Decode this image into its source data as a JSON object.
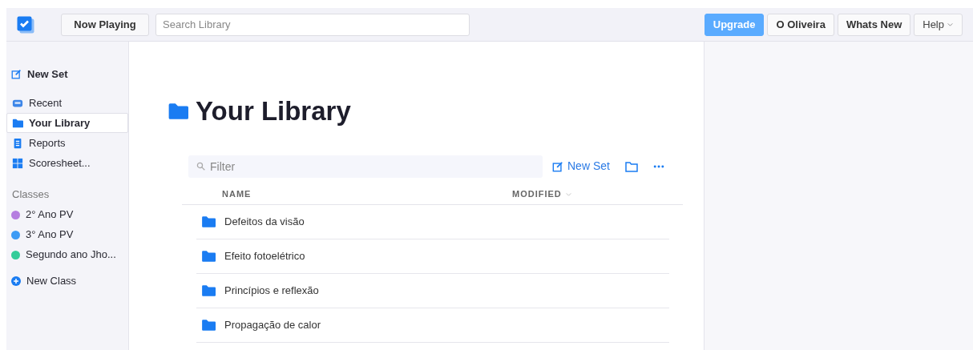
{
  "header": {
    "now_playing": "Now Playing",
    "search": {
      "placeholder": "Search Library"
    },
    "buttons": [
      {
        "label": "Upgrade",
        "kind": "primary"
      },
      {
        "label": "O Oliveira",
        "kind": "plain"
      },
      {
        "label": "Whats New",
        "kind": "plain"
      },
      {
        "label": "Help",
        "kind": "dropdown"
      }
    ]
  },
  "sidebar": {
    "new_set": "New Set",
    "items": [
      {
        "label": "Recent",
        "selected": false
      },
      {
        "label": "Your Library",
        "selected": true
      },
      {
        "label": "Reports",
        "selected": false
      },
      {
        "label": "Scoresheet...",
        "selected": false
      }
    ],
    "classes_heading": "Classes",
    "classes": [
      {
        "label": "2° Ano PV",
        "color": "#b57ee0"
      },
      {
        "label": "3° Ano PV",
        "color": "#3d9bf5"
      },
      {
        "label": "Segundo ano Jho...",
        "color": "#33cc99"
      }
    ],
    "new_class": "New Class"
  },
  "main": {
    "title": "Your Library",
    "filter": {
      "placeholder": "Filter"
    },
    "new_set": "New Set",
    "columns": [
      "NAME",
      "MODIFIED"
    ],
    "rows": [
      {
        "name": "Defeitos da visão"
      },
      {
        "name": "Efeito fotoelétrico"
      },
      {
        "name": "Princípios e reflexão"
      },
      {
        "name": "Propagação de calor"
      }
    ]
  }
}
